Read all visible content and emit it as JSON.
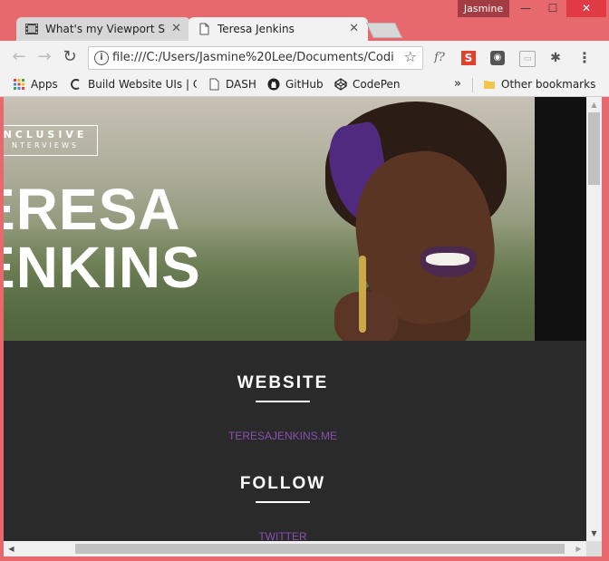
{
  "window": {
    "user": "Jasmine",
    "controls": {
      "minimize": "—",
      "maximize": "☐",
      "close": "✕"
    }
  },
  "tabs": [
    {
      "title": "What's my Viewport Size",
      "close": "✕",
      "active": false
    },
    {
      "title": "Teresa Jenkins",
      "close": "✕",
      "active": true
    }
  ],
  "toolbar": {
    "back": "←",
    "forward": "→",
    "reload": "↻",
    "url": "file:///C:/Users/Jasmine%20Lee/Documents/Codi",
    "star": "☆",
    "menu": "⋮"
  },
  "bookmarks": {
    "items": [
      {
        "label": "Apps",
        "icon": "apps-grid-icon"
      },
      {
        "label": "Build Website UIs | Co",
        "icon": "codepen-c-icon"
      },
      {
        "label": "DASH",
        "icon": "page-icon"
      },
      {
        "label": "GitHub",
        "icon": "github-icon"
      },
      {
        "label": "CodePen",
        "icon": "codepen-icon"
      }
    ],
    "overflow": "»",
    "other": "Other bookmarks"
  },
  "page": {
    "logo_line1": "NCLUSIVE",
    "logo_line2": "NTERVIEWS",
    "name_line1": "ERESA",
    "name_line2": "ENKINS",
    "sections": [
      {
        "heading": "WEBSITE",
        "link": "TERESAJENKINS.ME"
      },
      {
        "heading": "FOLLOW",
        "link": "TWITTER"
      }
    ]
  },
  "colors": {
    "chrome_frame": "#e8696d",
    "page_dark": "#2a2a2a",
    "link_purple": "#8a4fb3"
  }
}
